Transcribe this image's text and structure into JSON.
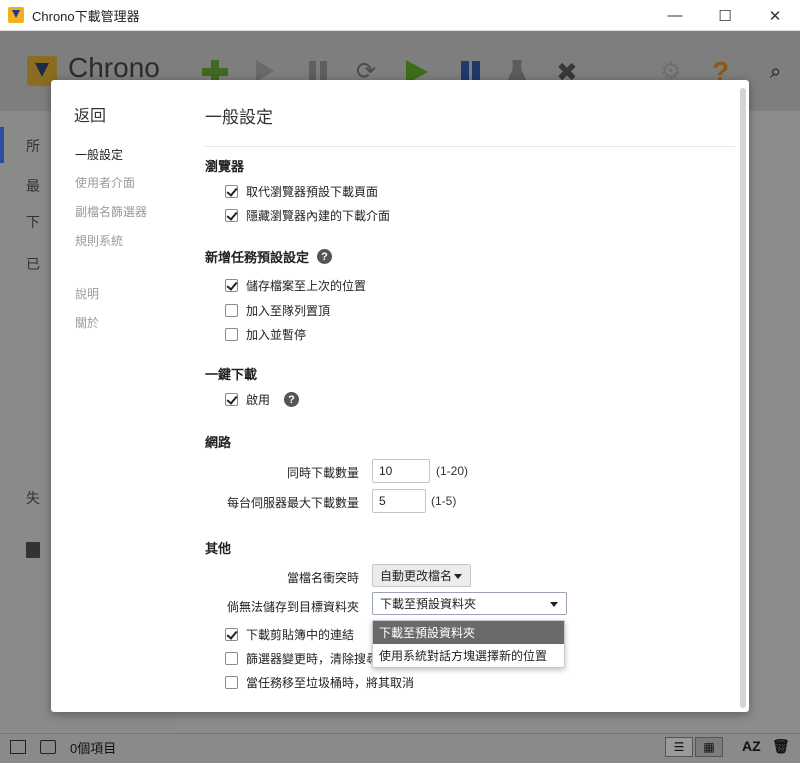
{
  "window": {
    "title": "Chrono下載管理器",
    "minimize": "—",
    "maximize": "☐",
    "close": "✕"
  },
  "app": {
    "brand": "Chrono",
    "sidebar_fragments": [
      "所",
      "最",
      "下",
      "已",
      "失"
    ],
    "toolbar_icons": [
      "add-icon",
      "play-icon",
      "pause-icon",
      "refresh-icon",
      "start-all-icon",
      "stop-all-icon",
      "clean-icon",
      "delete-icon",
      "settings-icon",
      "help-icon",
      "search-icon"
    ]
  },
  "statusbar": {
    "count_text": "0個項目",
    "sort_label": "AZ"
  },
  "dialog": {
    "back": "返回",
    "nav": [
      "一般設定",
      "使用者介面",
      "副檔名篩選器",
      "規則系統"
    ],
    "nav_secondary": [
      "說明",
      "關於"
    ],
    "active_nav": "一般設定",
    "title": "一般設定",
    "browser": {
      "heading": "瀏覽器",
      "options": [
        {
          "label": "取代瀏覽器預設下載頁面",
          "checked": true
        },
        {
          "label": "隱藏瀏覽器內建的下載介面",
          "checked": true
        }
      ]
    },
    "new_task": {
      "heading": "新增任務預設設定",
      "options": [
        {
          "label": "儲存檔案至上次的位置",
          "checked": true
        },
        {
          "label": "加入至隊列置頂",
          "checked": false
        },
        {
          "label": "加入並暫停",
          "checked": false
        }
      ]
    },
    "one_click": {
      "heading": "一鍵下載",
      "options": [
        {
          "label": "啟用",
          "checked": true
        }
      ]
    },
    "network": {
      "heading": "網路",
      "concurrent_label": "同時下載數量",
      "concurrent_value": "10",
      "concurrent_range": "(1-20)",
      "per_server_label": "每台伺服器最大下載數量",
      "per_server_value": "5",
      "per_server_range": "(1-5)"
    },
    "other": {
      "heading": "其他",
      "conflict_label": "當檔名衝突時",
      "conflict_value": "自動更改檔名",
      "cannot_save_label": "倘無法儲存到目標資料夾",
      "cannot_save_value": "下載至預設資料夾",
      "cannot_save_options": [
        "下載至預設資料夾",
        "使用系統對話方塊選擇新的位置"
      ],
      "options": [
        {
          "label": "下載剪貼簿中的連結",
          "checked": true
        },
        {
          "label": "篩選器變更時，清除搜尋",
          "checked": false
        },
        {
          "label": "當任務移至垃圾桶時，將其取消",
          "checked": false
        }
      ]
    }
  }
}
